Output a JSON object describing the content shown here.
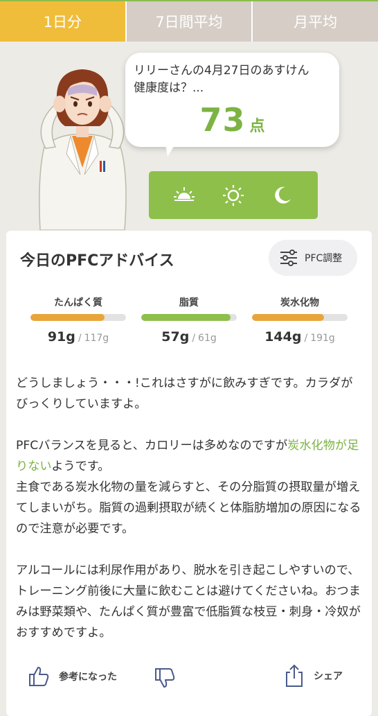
{
  "tabs": [
    {
      "label": "1日分",
      "active": true
    },
    {
      "label": "7日間平均",
      "active": false
    },
    {
      "label": "月平均",
      "active": false
    }
  ],
  "bubble": {
    "question_line1": "リリーさんの4月27日のあすけん",
    "question_line2": "健康度は？...",
    "score": "73",
    "score_unit": "点"
  },
  "time_toggle": {
    "icons": [
      "sunrise-icon",
      "sun-icon",
      "moon-icon"
    ]
  },
  "card": {
    "title": "今日のPFCアドバイス",
    "pfc_button_label": "PFC調整",
    "nutrients": [
      {
        "label": "たんぱく質",
        "value": "91g",
        "target": "117g",
        "ratio": 0.778,
        "color": "#e9a53a"
      },
      {
        "label": "脂質",
        "value": "57g",
        "target": "61g",
        "ratio": 0.934,
        "color": "#8dbf4a"
      },
      {
        "label": "炭水化物",
        "value": "144g",
        "target": "191g",
        "ratio": 0.754,
        "color": "#e9a53a"
      }
    ],
    "separator": "/",
    "advice": {
      "p1": "どうしましょう・・・!これはさすがに飲みすぎです。カラダがびっくりしていますよ。",
      "p2_before": "PFCバランスを見ると、カロリーは多めなのですが",
      "p2_highlight": "炭水化物が足りない",
      "p2_after": "ようです。",
      "p2_line2": "主食である炭水化物の量を減らすと、その分脂質の摂取量が増えてしまいがち。脂質の過剰摂取が続くと体脂肪増加の原因になるので注意が必要です。",
      "p3": "アルコールには利尿作用があり、脱水を引き起こしやすいので、トレーニング前後に大量に飲むことは避けてくださいね。おつまみは野菜類や、たんぱく質が豊富で低脂質な枝豆・刺身・冷奴がおすすめですよ。"
    },
    "actions": {
      "helpful_label": "参考になった",
      "share_label": "シェア"
    }
  },
  "colors": {
    "accent_green": "#7cb342",
    "tab_active": "#f0bd3a",
    "tab_inactive": "#d5cdc6",
    "toggle_bg": "#8dbf4a"
  }
}
